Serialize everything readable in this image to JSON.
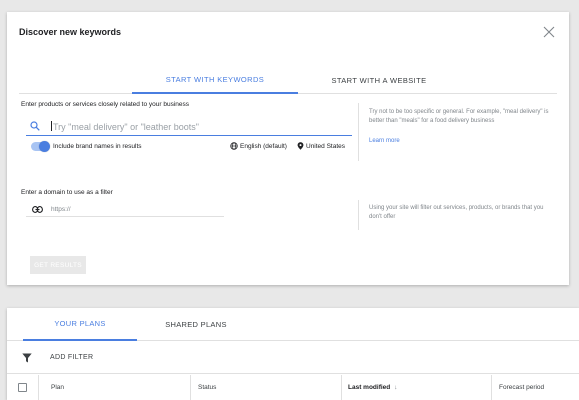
{
  "dialog": {
    "title": "Discover new keywords",
    "tabs": [
      {
        "label": "START WITH KEYWORDS",
        "active": true
      },
      {
        "label": "START WITH A WEBSITE",
        "active": false
      }
    ],
    "keywords_section": {
      "label": "Enter products or services closely related to your business",
      "search_placeholder": "Try \"meal delivery\" or \"leather boots\"",
      "search_value": "",
      "brand_toggle_label": "Include brand names in results",
      "brand_toggle_on": true,
      "language": "English (default)",
      "location": "United States",
      "help_text": "Try not to be too specific or general. For example, \"meal delivery\" is better than \"meals\" for a food delivery business",
      "learn_more": "Learn more"
    },
    "domain_section": {
      "label": "Enter a domain to use as a filter",
      "placeholder": "https://",
      "help_text": "Using your site will filter out services, products, or brands that you don't offer"
    },
    "get_results_label": "GET RESULTS"
  },
  "plans": {
    "tabs": [
      {
        "label": "YOUR PLANS",
        "active": true
      },
      {
        "label": "SHARED PLANS",
        "active": false
      }
    ],
    "add_filter_label": "ADD FILTER",
    "columns": [
      "Plan",
      "Status",
      "Last modified",
      "Forecast period"
    ],
    "sort_indicator": "↓"
  },
  "colors": {
    "accent": "#4a7ee0",
    "background": "#e8e8e8"
  }
}
